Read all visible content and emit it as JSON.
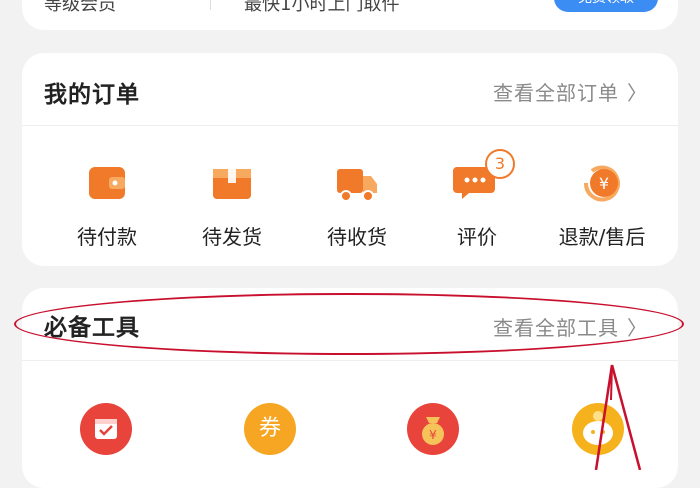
{
  "top_card": {
    "left_text": "等级会员",
    "mid_text": "最快1小时上门取件",
    "pill_label": "免费领取"
  },
  "orders": {
    "title": "我的订单",
    "view_all": "查看全部订单",
    "items": [
      {
        "label": "待付款",
        "icon": "wallet-icon"
      },
      {
        "label": "待发货",
        "icon": "package-icon"
      },
      {
        "label": "待收货",
        "icon": "truck-icon"
      },
      {
        "label": "评价",
        "icon": "comment-icon",
        "badge": "3"
      },
      {
        "label": "退款/售后",
        "icon": "refund-yen-icon"
      }
    ]
  },
  "tools": {
    "title": "必备工具",
    "view_all": "查看全部工具",
    "items": [
      {
        "icon": "calendar-check-icon",
        "color": "#e8443c"
      },
      {
        "icon": "coupon-icon",
        "color": "#f6a623",
        "glyph": "券"
      },
      {
        "icon": "money-bag-icon",
        "color": "#e8443c"
      },
      {
        "icon": "piggy-icon",
        "color": "#f6b21c"
      }
    ]
  },
  "colors": {
    "accent_orange": "#f07a2a",
    "annotation_red": "#c8102e",
    "link_gray": "#8a8a8a"
  }
}
